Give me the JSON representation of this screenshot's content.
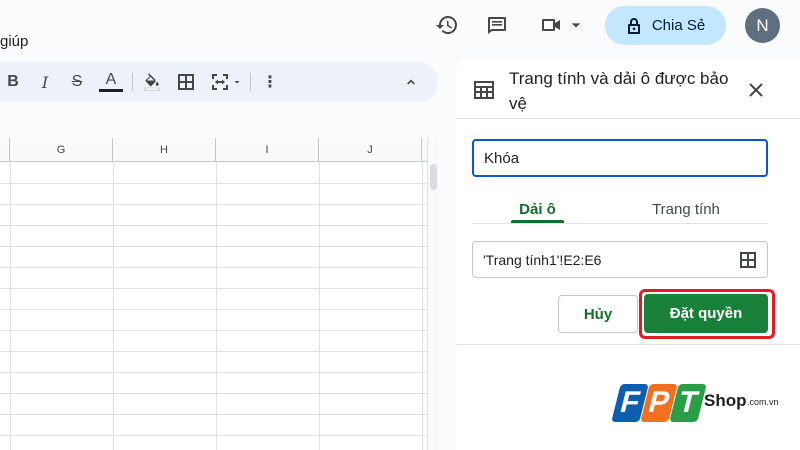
{
  "menubar": {
    "help_fragment": "giúp"
  },
  "header": {
    "share_label": "Chia Sẻ",
    "avatar_initial": "N",
    "icons": [
      "history-icon",
      "comment-icon",
      "meet-icon",
      "lock-icon"
    ]
  },
  "toolbar": {
    "bold_label": "B",
    "italic_label": "I",
    "strike_label": "S",
    "text_color_label": "A",
    "more_label": "⋮"
  },
  "sheet": {
    "columns": [
      "G",
      "H",
      "I",
      "J"
    ]
  },
  "panel": {
    "title": "Trang tính và dải ô được bảo vệ",
    "description_value": "Khóa",
    "tabs": [
      {
        "label": "Dải ô",
        "active": true
      },
      {
        "label": "Trang tính",
        "active": false
      }
    ],
    "range_value": "'Trang tính1'!E2:E6",
    "cancel_label": "Hủy",
    "set_permissions_label": "Đặt quyền"
  },
  "watermark": {
    "letters": [
      "F",
      "P",
      "T"
    ],
    "shop": "Shop",
    "domain": ".com.vn"
  },
  "colors": {
    "primary_green": "#188038",
    "tab_green": "#146c2e",
    "share_bg": "#c2e7ff",
    "highlight_red": "#e21c24",
    "focus_blue": "#0b57d0"
  }
}
